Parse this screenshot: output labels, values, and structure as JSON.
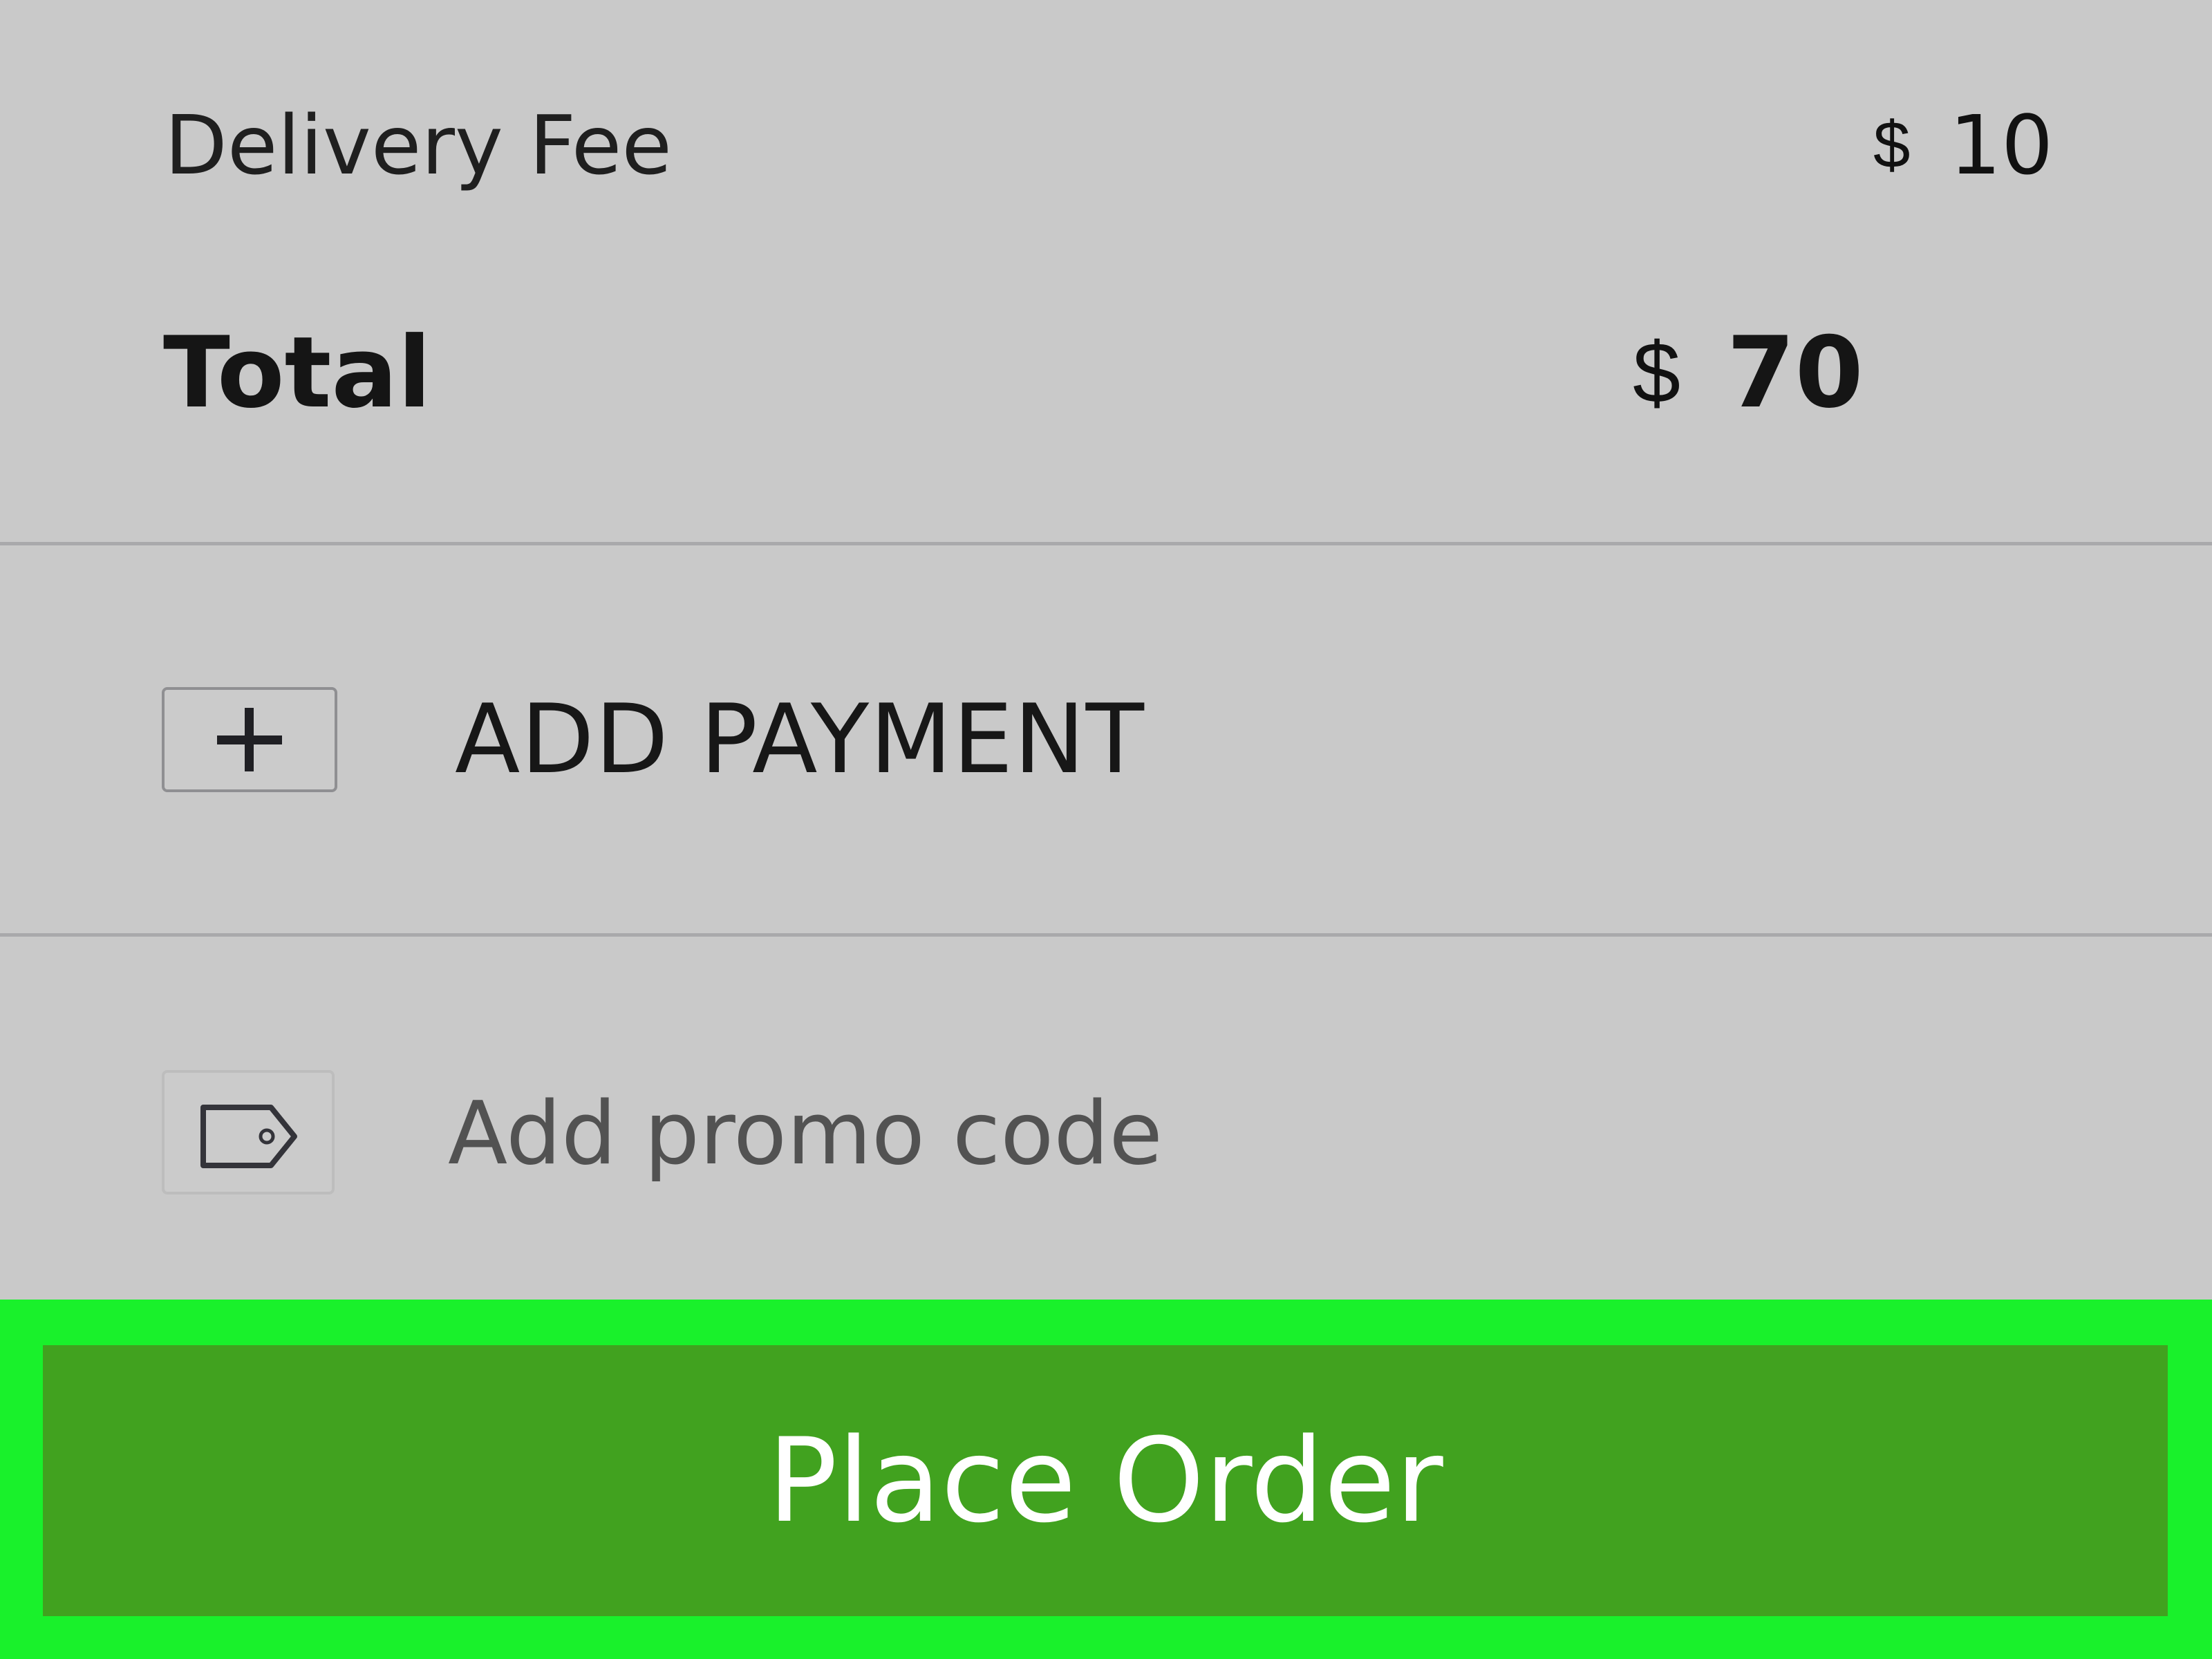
{
  "summary": {
    "delivery_fee": {
      "label": "Delivery Fee",
      "currency": "$",
      "amount": "10"
    },
    "total": {
      "label": "Total",
      "currency": "$",
      "amount": "70"
    }
  },
  "payment": {
    "label": "ADD PAYMENT",
    "icon": "plus-icon"
  },
  "promo": {
    "label": "Add promo code",
    "icon": "tag-icon"
  },
  "actions": {
    "place_order_label": "Place Order"
  },
  "colors": {
    "background": "#c9c9c9",
    "highlight": "#19f12b",
    "button": "#41a21f",
    "button_text": "#ffffff"
  }
}
